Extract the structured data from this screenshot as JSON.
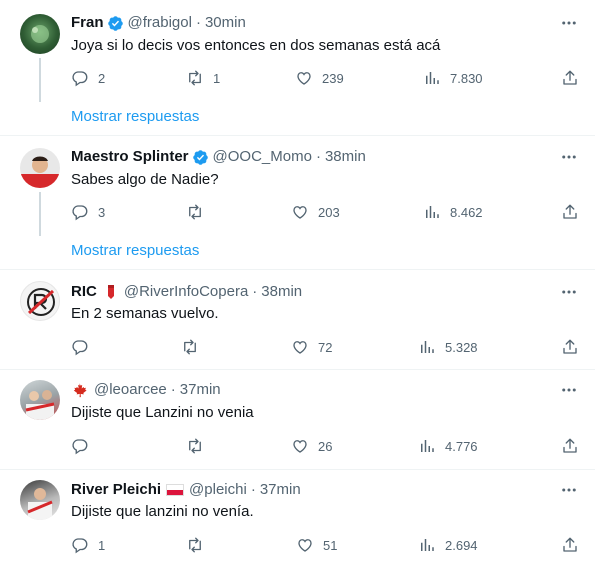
{
  "tweets": [
    {
      "name": "Fran",
      "handle": "@frabigol",
      "time": "30min",
      "text": "Joya si lo decis vos entonces en dos semanas está acá",
      "replies": "2",
      "retweets": "1",
      "likes": "239",
      "views": "7.830",
      "show_replies": "Mostrar respuestas"
    },
    {
      "name": "Maestro Splinter",
      "handle": "@OOC_Momo",
      "time": "38min",
      "text": "Sabes algo de Nadie?",
      "replies": "3",
      "retweets": "",
      "likes": "203",
      "views": "8.462",
      "show_replies": "Mostrar respuestas"
    },
    {
      "name": "RIC",
      "handle": "@RiverInfoCopera",
      "time": "38min",
      "text": "En 2 semanas vuelvo.",
      "replies": "",
      "retweets": "",
      "likes": "72",
      "views": "5.328"
    },
    {
      "name": "",
      "handle": "@leoarcee",
      "time": "37min",
      "text": "Dijiste que Lanzini no venia",
      "replies": "",
      "retweets": "",
      "likes": "26",
      "views": "4.776"
    },
    {
      "name": "River Pleichi",
      "handle": "@pleichi",
      "time": "37min",
      "text": "Dijiste que lanzini no venía.",
      "replies": "1",
      "retweets": "",
      "likes": "51",
      "views": "2.694"
    }
  ],
  "separator": "·",
  "colors": {
    "accent": "#1d9bf0",
    "muted": "#536471",
    "text": "#0f1419",
    "divider": "#eff3f4"
  }
}
